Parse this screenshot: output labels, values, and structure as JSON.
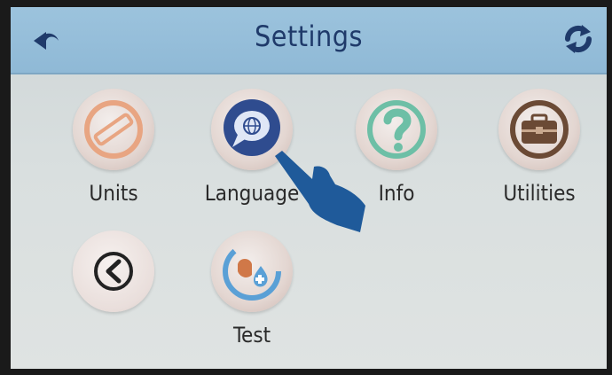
{
  "header": {
    "title": "Settings"
  },
  "tiles": {
    "units": {
      "label": "Units",
      "icon": "ruler-icon"
    },
    "language": {
      "label": "Language",
      "icon": "globe-speech-icon"
    },
    "info": {
      "label": "Info",
      "icon": "question-icon"
    },
    "utilities": {
      "label": "Utilities",
      "icon": "toolbox-icon"
    },
    "back": {
      "label": "",
      "icon": "chevron-left-icon"
    },
    "test": {
      "label": "Test",
      "icon": "hand-drop-icon"
    }
  },
  "colors": {
    "topbar": "#8fb9d6",
    "title": "#1f3a6a",
    "units_accent": "#e8a582",
    "language_accent": "#2f4c8f",
    "info_accent": "#6dbfa6",
    "utilities_accent": "#6b4a35",
    "pointer_hand": "#1f5a9a"
  }
}
